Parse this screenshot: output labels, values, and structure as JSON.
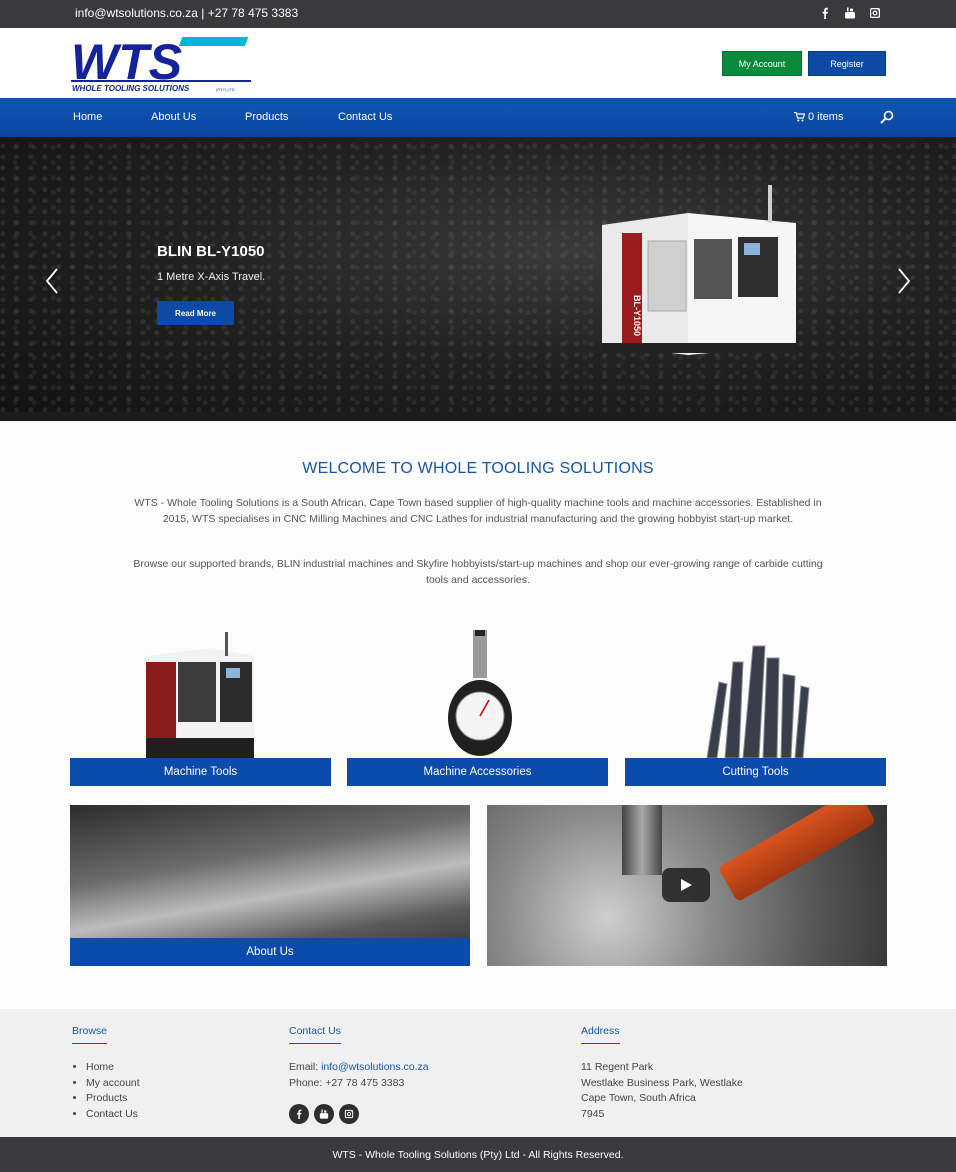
{
  "topbar": {
    "contact": "info@wtsolutions.co.za | +27 78 475 3383",
    "social_icons": [
      "facebook-icon",
      "youtube-icon",
      "instagram-icon"
    ]
  },
  "header": {
    "logo_text": "WTS",
    "logo_tagline": "WHOLE TOOLING SOLUTIONS",
    "logo_suffix": "(PTY) LTD",
    "my_account": "My Account",
    "register": "Register"
  },
  "nav": {
    "items": [
      "Home",
      "About Us",
      "Products",
      "Contact Us"
    ],
    "cart": "0 items"
  },
  "hero": {
    "title": "BLIN BL-Y1050",
    "subtitle": "1 Metre X-Axis Travel.",
    "button": "Read More",
    "machine_label": "BL-Y1050"
  },
  "welcome": {
    "title": "WELCOME TO WHOLE TOOLING SOLUTIONS",
    "p1": "WTS - Whole Tooling Solutions is a South African, Cape Town based supplier of high-quality machine tools and machine accessories. Established in 2015, WTS specialises in CNC Milling Machines and CNC Lathes for industrial manufacturing and the growing hobbyist start-up market.",
    "p2": "Browse our supported brands, BLIN industrial machines and Skyfire hobbyists/start-up machines and shop our ever-growing range of carbide cutting tools and accessories."
  },
  "categories": [
    "Machine Tools",
    "Machine Accessories",
    "Cutting Tools"
  ],
  "tiles": {
    "about": "About Us"
  },
  "footer": {
    "browse": {
      "title": "Browse",
      "items": [
        "Home",
        "My account",
        "Products",
        "Contact Us"
      ]
    },
    "contact": {
      "title": "Contact Us",
      "email_label": "Email: ",
      "email": "info@wtsolutions.co.za",
      "phone": "Phone: +27 78 475 3383"
    },
    "address": {
      "title": "Address",
      "lines": [
        "11 Regent Park",
        "Westlake Business Park, Westlake",
        "Cape Town, South Africa",
        "7945"
      ]
    },
    "copyright": "WTS - Whole Tooling Solutions (Pty) Ltd - All Rights Reserved."
  },
  "colors": {
    "brand_blue": "#0a4bab",
    "account_green": "#0a8a3b",
    "dark_bar": "#3a3a3c"
  }
}
